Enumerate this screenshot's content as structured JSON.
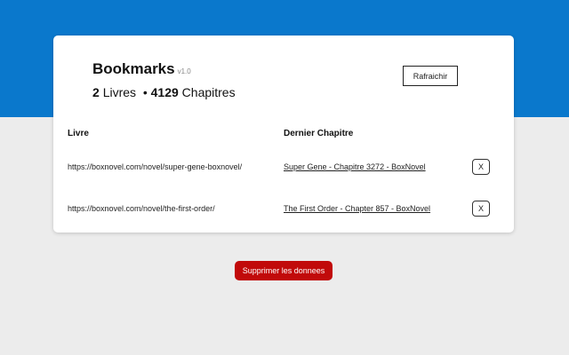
{
  "header": {
    "title": "Bookmarks",
    "version": "v1.0",
    "books_count": "2",
    "books_label": "Livres",
    "separator": "•",
    "chapters_count": "4129",
    "chapters_label": "Chapitres",
    "refresh_label": "Rafraichir"
  },
  "table": {
    "columns": [
      "Livre",
      "Dernier Chapitre"
    ],
    "rows": [
      {
        "url": "https://boxnovel.com/novel/super-gene-boxnovel/",
        "chapter": "Super Gene - Chapitre 3272 - BoxNovel",
        "delete_label": "X"
      },
      {
        "url": "https://boxnovel.com/novel/the-first-order/",
        "chapter": "The First Order - Chapter 857 - BoxNovel",
        "delete_label": "X"
      }
    ]
  },
  "footer": {
    "delete_data_label": "Supprimer les donnees"
  },
  "colors": {
    "brand_blue": "#0a78cc",
    "danger_red": "#c10a0a",
    "background": "#ececec"
  }
}
